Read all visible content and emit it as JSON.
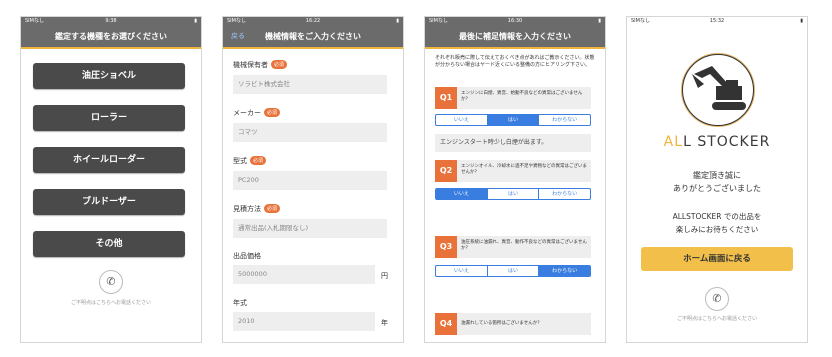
{
  "screen1": {
    "status": {
      "carrier": "SIMなし",
      "time": "9:38"
    },
    "title": "鑑定する機種をお選びください",
    "buttons": [
      "油圧ショベル",
      "ローラー",
      "ホイールローダー",
      "ブルドーザー",
      "その他"
    ],
    "contact": "ご不明点はこちらへお電話ください"
  },
  "screen2": {
    "status": {
      "carrier": "SIMなし",
      "time": "16:22"
    },
    "back": "戻る",
    "title": "機械情報をご入力ください",
    "required": "必須",
    "fields": [
      {
        "label": "機械保有者",
        "value": "ソラビト株式会社",
        "required": true
      },
      {
        "label": "メーカー",
        "value": "コマツ",
        "required": true
      },
      {
        "label": "型式",
        "value": "PC200",
        "required": true
      },
      {
        "label": "見積方法",
        "value": "通常出品(入札期限なし)",
        "required": true
      },
      {
        "label": "出品価格",
        "value": "5000000",
        "required": false,
        "unit": "円"
      },
      {
        "label": "年式",
        "value": "2010",
        "required": false,
        "unit": "年"
      }
    ]
  },
  "screen3": {
    "status": {
      "carrier": "SIMなし",
      "time": "16:30"
    },
    "title": "最後に補足情報を入力ください",
    "intro": "それぞれ販売に際して伝えておくべき点があればご教示ください。状態が分からない場合はヤード近くにいる整備の方にヒアリング下さい。",
    "options": [
      "いいえ",
      "はい",
      "わからない"
    ],
    "questions": [
      {
        "no": "Q1",
        "text": "エンジンに白煙、異音、始動不良などの異常はございませんか？",
        "selected": 1,
        "answer": "エンジンスタート時少し白煙が出ます。"
      },
      {
        "no": "Q2",
        "text": "エンジンオイル、冷却水に過不足や異物などの異常はございませんか？",
        "selected": 0
      },
      {
        "no": "Q3",
        "text": "油圧系統に油漏れ、異音、動作不良などの異常はございませんか？",
        "selected": 2
      },
      {
        "no": "Q4",
        "text": "油漏れしている箇所はございませんか？"
      }
    ]
  },
  "screen4": {
    "status": {
      "carrier": "SIMなし",
      "time": "15:32"
    },
    "brand_prefix": "AL",
    "brand_rest": "L STOCKER",
    "thanks_line1": "鑑定頂き誠に",
    "thanks_line2": "ありがとうございました",
    "msg_line1": "ALLSTOCKER での出品を",
    "msg_line2": "楽しみにお待ちください",
    "home_button": "ホーム画面に戻る",
    "contact": "ご不明点はこちらへお電話ください"
  }
}
